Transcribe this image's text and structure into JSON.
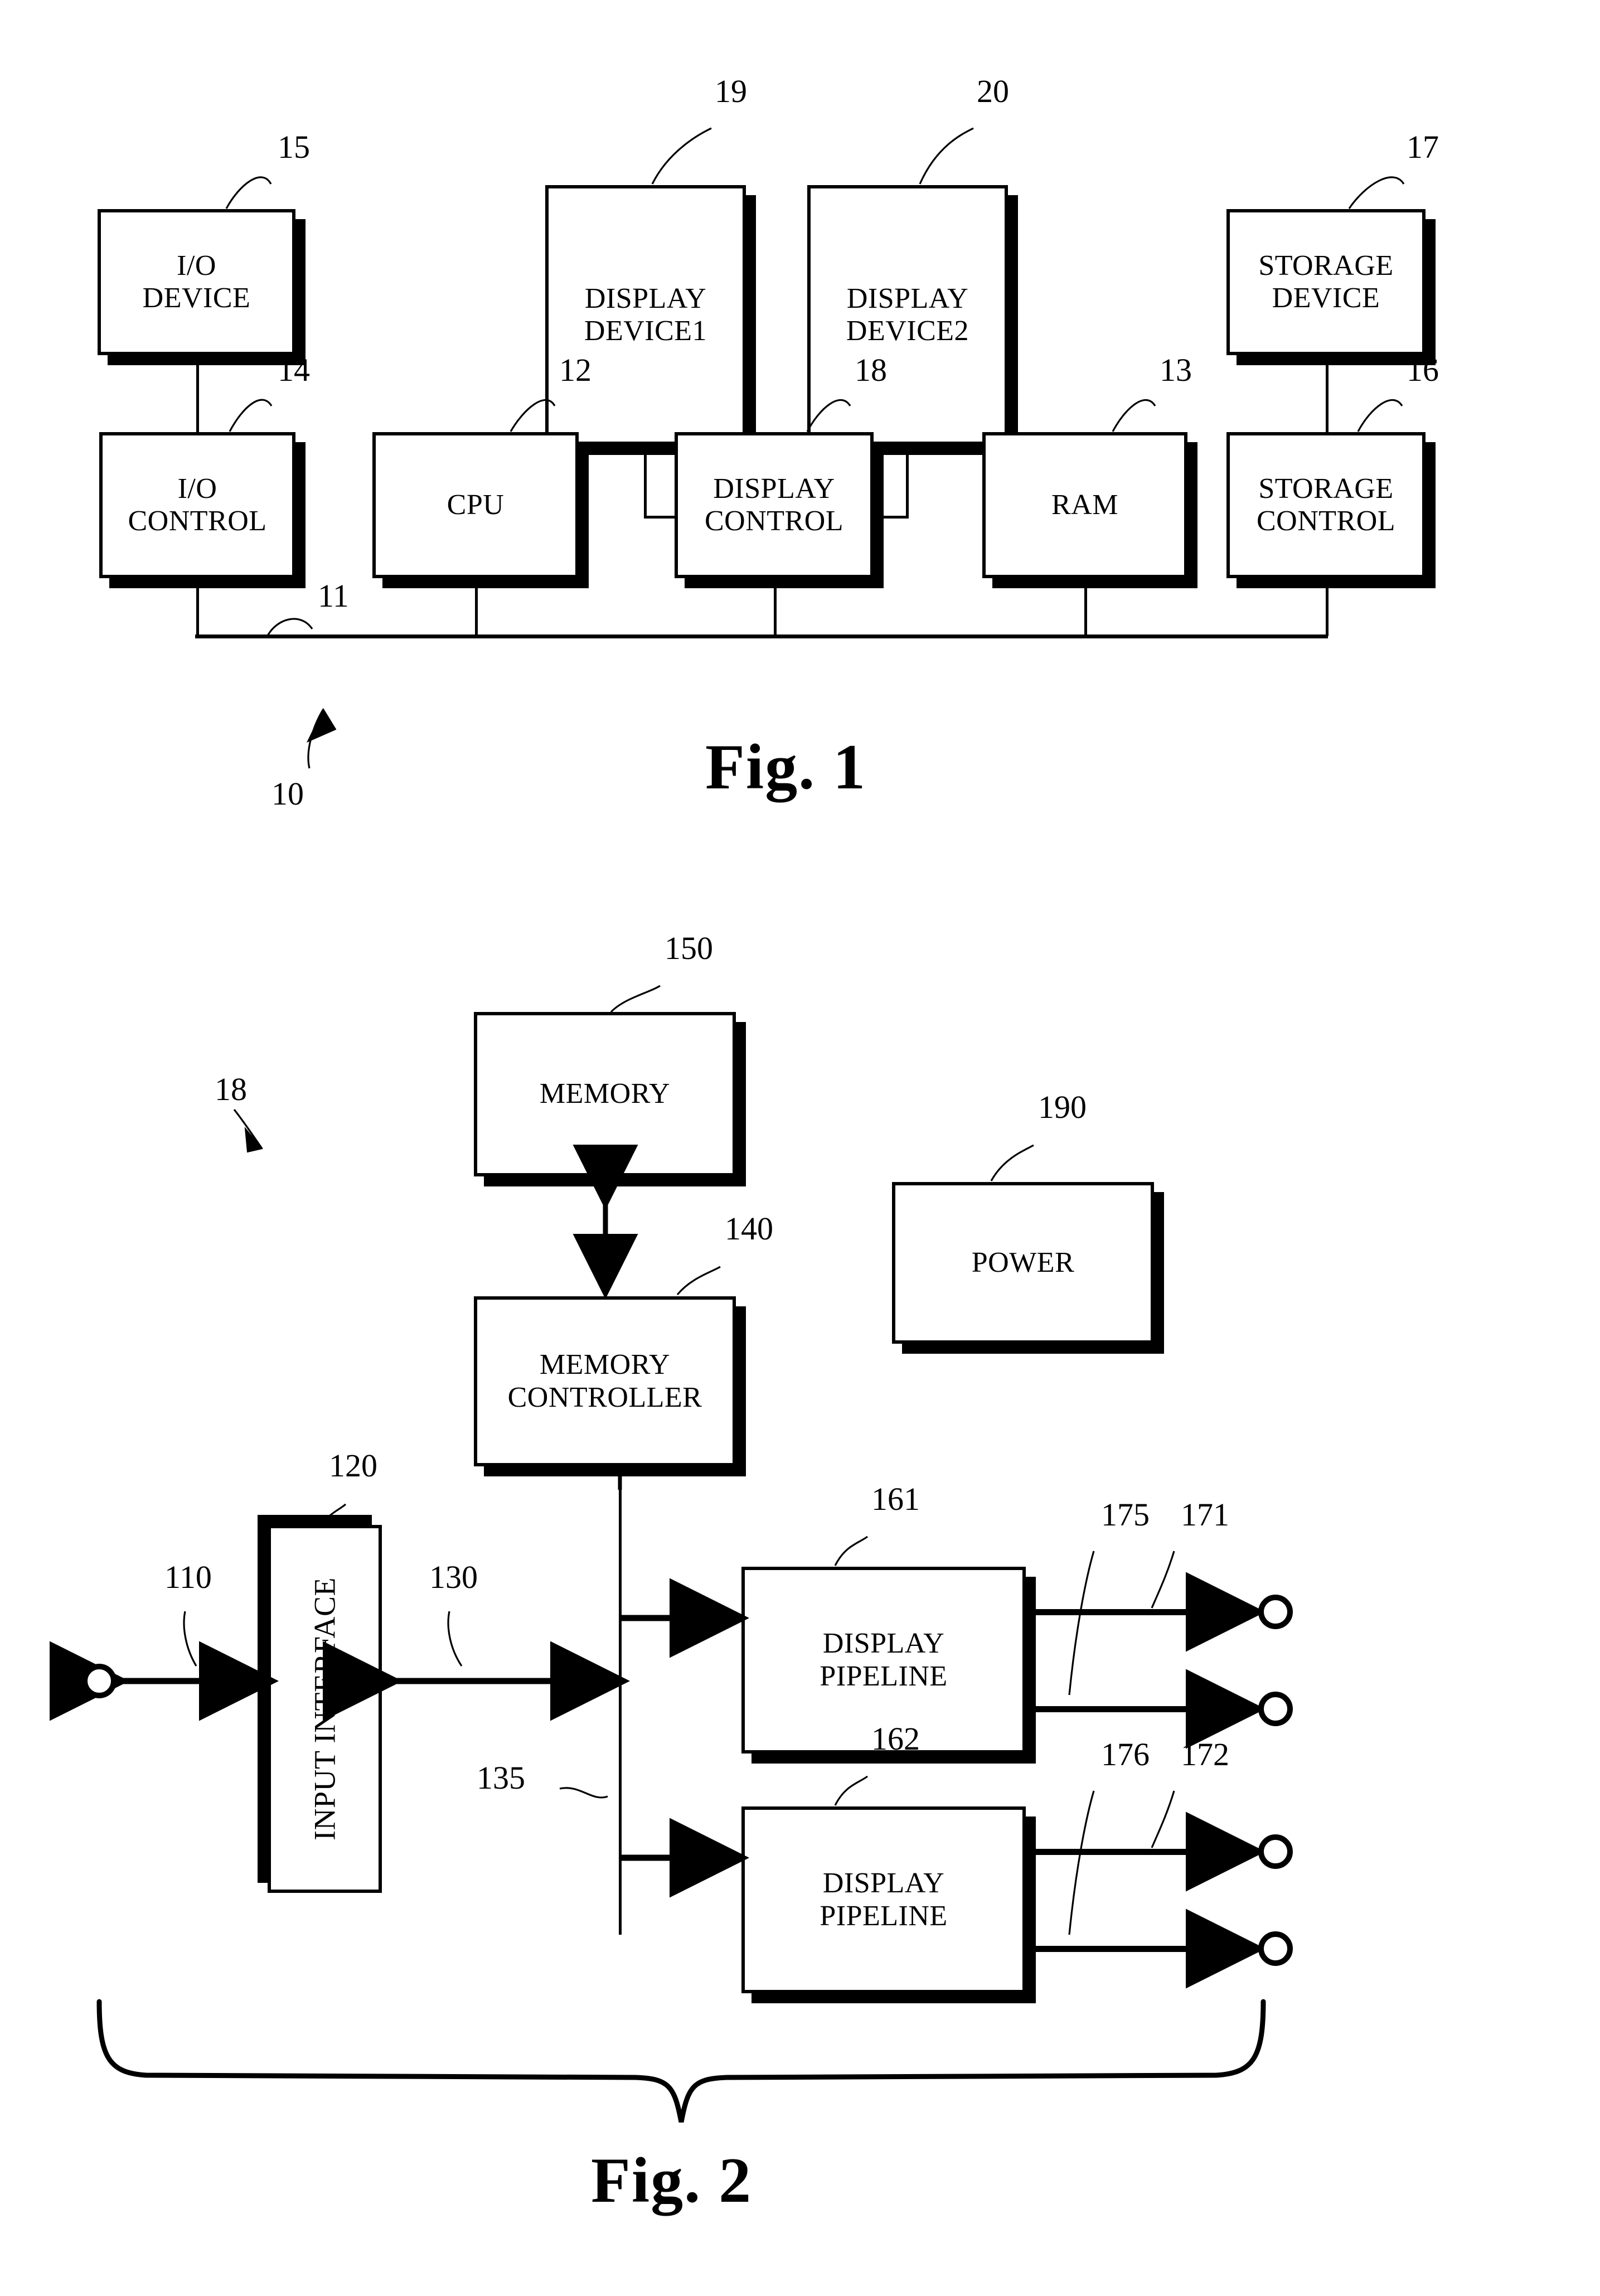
{
  "figures": [
    {
      "caption": "Fig. 1",
      "system_ref": "10",
      "blocks": [
        {
          "id": "io-device",
          "label": "I/O\nDEVICE",
          "ref": "15"
        },
        {
          "id": "io-control",
          "label": "I/O\nCONTROL",
          "ref": "14"
        },
        {
          "id": "cpu",
          "label": "CPU",
          "ref": "12"
        },
        {
          "id": "display-device1",
          "label": "DISPLAY\nDEVICE1",
          "ref": "19"
        },
        {
          "id": "display-device2",
          "label": "DISPLAY\nDEVICE2",
          "ref": "20"
        },
        {
          "id": "display-control",
          "label": "DISPLAY\nCONTROL",
          "ref": "18"
        },
        {
          "id": "ram",
          "label": "RAM",
          "ref": "13"
        },
        {
          "id": "storage-device",
          "label": "STORAGE\nDEVICE",
          "ref": "17"
        },
        {
          "id": "storage-control",
          "label": "STORAGE\nCONTROL",
          "ref": "16"
        }
      ],
      "bus_ref": "11"
    },
    {
      "caption": "Fig. 2",
      "system_ref": "18",
      "blocks": [
        {
          "id": "memory",
          "label": "MEMORY",
          "ref": "150"
        },
        {
          "id": "memory-controller",
          "label": "MEMORY\nCONTROLLER",
          "ref": "140"
        },
        {
          "id": "power",
          "label": "POWER",
          "ref": "190"
        },
        {
          "id": "input-interface",
          "label": "INPUT INTERFACE",
          "ref": "120"
        },
        {
          "id": "display-pipeline1",
          "label": "DISPLAY\nPIPELINE",
          "ref": "161"
        },
        {
          "id": "display-pipeline2",
          "label": "DISPLAY\nPIPELINE",
          "ref": "162"
        }
      ],
      "signal_refs": {
        "input_port": "110",
        "internal_bus": "130",
        "bus_branch": "135",
        "out1a": "175",
        "out1b": "171",
        "out2a": "176",
        "out2b": "172"
      }
    }
  ],
  "fig1": {
    "caption": "Fig. 1",
    "system_ref": "10",
    "bus_ref": "11",
    "io_device": {
      "label": "I/O\nDEVICE",
      "ref": "15"
    },
    "io_control": {
      "label": "I/O\nCONTROL",
      "ref": "14"
    },
    "cpu": {
      "label": "CPU",
      "ref": "12"
    },
    "display_device1": {
      "label": "DISPLAY\nDEVICE1",
      "ref": "19"
    },
    "display_device2": {
      "label": "DISPLAY\nDEVICE2",
      "ref": "20"
    },
    "display_control": {
      "label": "DISPLAY\nCONTROL",
      "ref": "18"
    },
    "ram": {
      "label": "RAM",
      "ref": "13"
    },
    "storage_device": {
      "label": "STORAGE\nDEVICE",
      "ref": "17"
    },
    "storage_control": {
      "label": "STORAGE\nCONTROL",
      "ref": "16"
    }
  },
  "fig2": {
    "caption": "Fig. 2",
    "system_ref": "18",
    "memory": {
      "label": "MEMORY",
      "ref": "150"
    },
    "memory_controller": {
      "label": "MEMORY\nCONTROLLER",
      "ref": "140"
    },
    "power": {
      "label": "POWER",
      "ref": "190"
    },
    "input_interface": {
      "label": "INPUT INTERFACE",
      "ref": "120"
    },
    "display_pipeline1": {
      "label": "DISPLAY\nPIPELINE",
      "ref": "161"
    },
    "display_pipeline2": {
      "label": "DISPLAY\nPIPELINE",
      "ref": "162"
    },
    "input_port_ref": "110",
    "internal_bus_ref": "130",
    "bus_branch_ref": "135",
    "out1a_ref": "175",
    "out1b_ref": "171",
    "out2a_ref": "176",
    "out2b_ref": "172"
  }
}
